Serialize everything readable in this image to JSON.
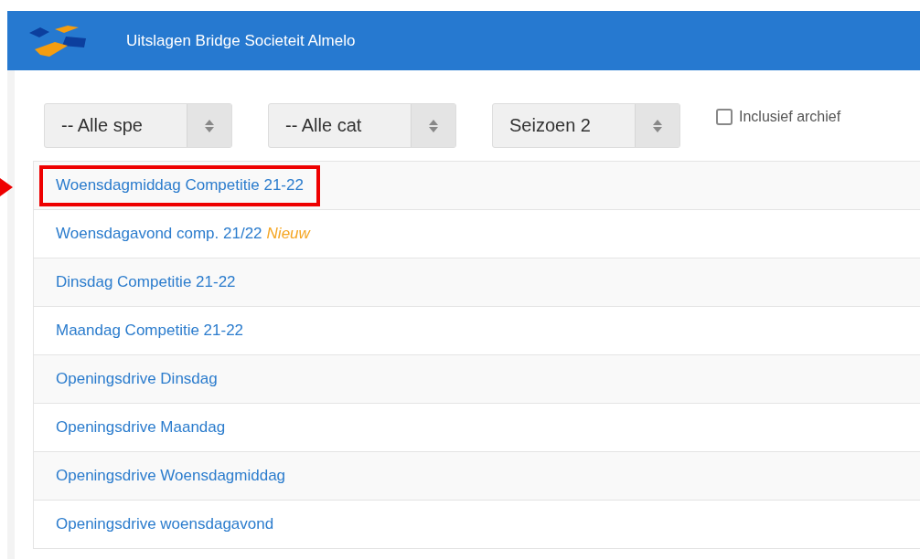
{
  "header": {
    "title": "Uitslagen Bridge Societeit Almelo"
  },
  "filters": [
    {
      "value": "-- Alle spe"
    },
    {
      "value": "-- Alle cat"
    },
    {
      "value": "Seizoen 2"
    }
  ],
  "archive": {
    "label": "Inclusief archief",
    "checked": false
  },
  "competitions": [
    {
      "name": "Woensdagmiddag Competitie 21-22",
      "highlighted": true
    },
    {
      "name": "Woensdagavond comp. 21/22",
      "badge": "Nieuw",
      "highlighted": false
    },
    {
      "name": "Dinsdag Competitie 21-22",
      "highlighted": false
    },
    {
      "name": "Maandag Competitie 21-22",
      "highlighted": false
    },
    {
      "name": "Openingsdrive Dinsdag",
      "highlighted": false
    },
    {
      "name": "Openingsdrive Maandag",
      "highlighted": false
    },
    {
      "name": "Openingsdrive Woensdagmiddag",
      "highlighted": false
    },
    {
      "name": "Openingsdrive woensdagavond",
      "highlighted": false
    }
  ]
}
